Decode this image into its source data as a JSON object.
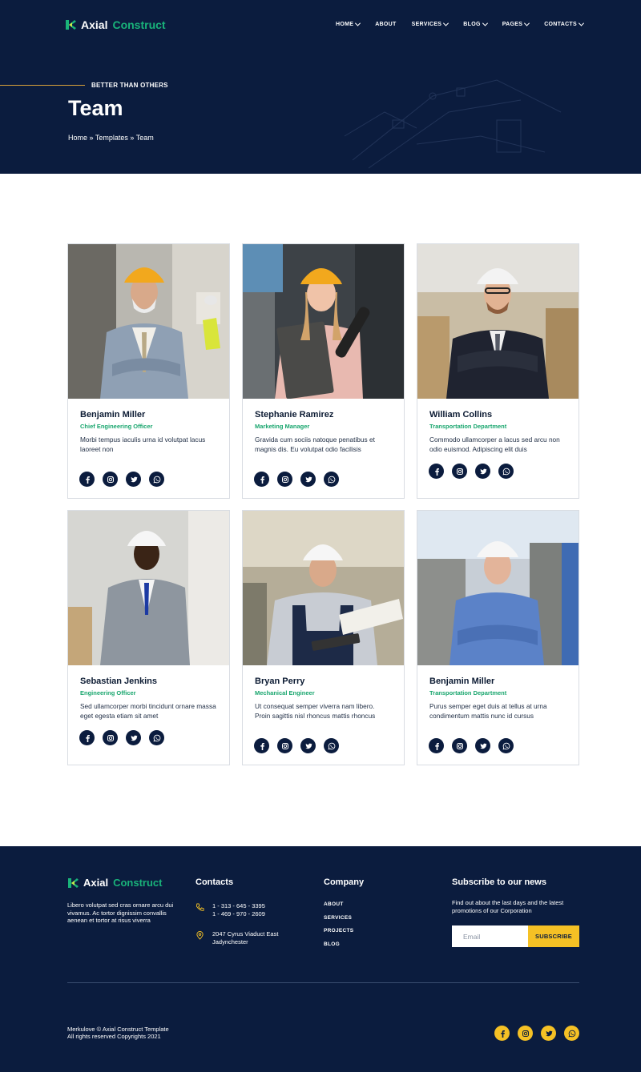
{
  "brand": {
    "word1": "Axial",
    "word2": "Construct"
  },
  "nav": [
    {
      "label": "HOME",
      "dropdown": true
    },
    {
      "label": "ABOUT",
      "dropdown": false
    },
    {
      "label": "SERVICES",
      "dropdown": true
    },
    {
      "label": "BLOG",
      "dropdown": true
    },
    {
      "label": "PAGES",
      "dropdown": true
    },
    {
      "label": "CONTACTS",
      "dropdown": true
    }
  ],
  "hero": {
    "eyebrow": "BETTER THAN OTHERS",
    "title": "Team",
    "breadcrumb": "Home » Templates » Team"
  },
  "team": [
    {
      "name": "Benjamin Miller",
      "role": "Chief Engineering Officer",
      "bio": "Morbi tempus iaculis urna id volutpat lacus laoreet non"
    },
    {
      "name": "Stephanie Ramirez",
      "role": "Marketing Manager",
      "bio": "Gravida cum sociis natoque penatibus et magnis dis. Eu volutpat odio facilisis"
    },
    {
      "name": "William Collins",
      "role": "Transportation Department",
      "bio": "Commodo ullamcorper a lacus sed arcu non odio euismod. Adipiscing elit duis"
    },
    {
      "name": "Sebastian Jenkins",
      "role": "Engineering Officer",
      "bio": "Sed ullamcorper morbi tincidunt ornare massa eget egesta etiam sit amet"
    },
    {
      "name": "Bryan Perry",
      "role": "Mechanical Engineer",
      "bio": "Ut consequat semper viverra nam libero. Proin sagittis nisl rhoncus mattis rhoncus"
    },
    {
      "name": "Benjamin Miller",
      "role": "Transportation Department",
      "bio": "Purus semper eget duis at tellus at urna condimentum mattis nunc id cursus"
    }
  ],
  "social_icons": [
    "facebook-icon",
    "instagram-icon",
    "twitter-icon",
    "whatsapp-icon"
  ],
  "footer": {
    "about": "Libero volutpat sed cras ornare arcu dui vivamus. Ac tortor dignissim convallis aenean et tortor at risus viverra",
    "contacts_title": "Contacts",
    "phone1": "1 - 313 - 645 - 3395",
    "phone2": "1 - 469 - 970 - 2609",
    "address1": "2047 Cyrus Viaduct East",
    "address2": "Jadynchester",
    "company_title": "Company",
    "company_links": [
      "ABOUT",
      "SERVICES",
      "PROJECTS",
      "BLOG"
    ],
    "news_title": "Subscribe to our news",
    "news_text": "Find out about the last days and the latest promotions of our Corporation",
    "email_placeholder": "Email",
    "subscribe_label": "SUBSCRIBE",
    "copy1": "Merkulove © Axial Construct Template",
    "copy2": "All rights reserved Copyrights 2021"
  },
  "colors": {
    "navy": "#0b1c3e",
    "green": "#19a66e",
    "yellow": "#f5c125",
    "gold": "#d9a23a"
  }
}
